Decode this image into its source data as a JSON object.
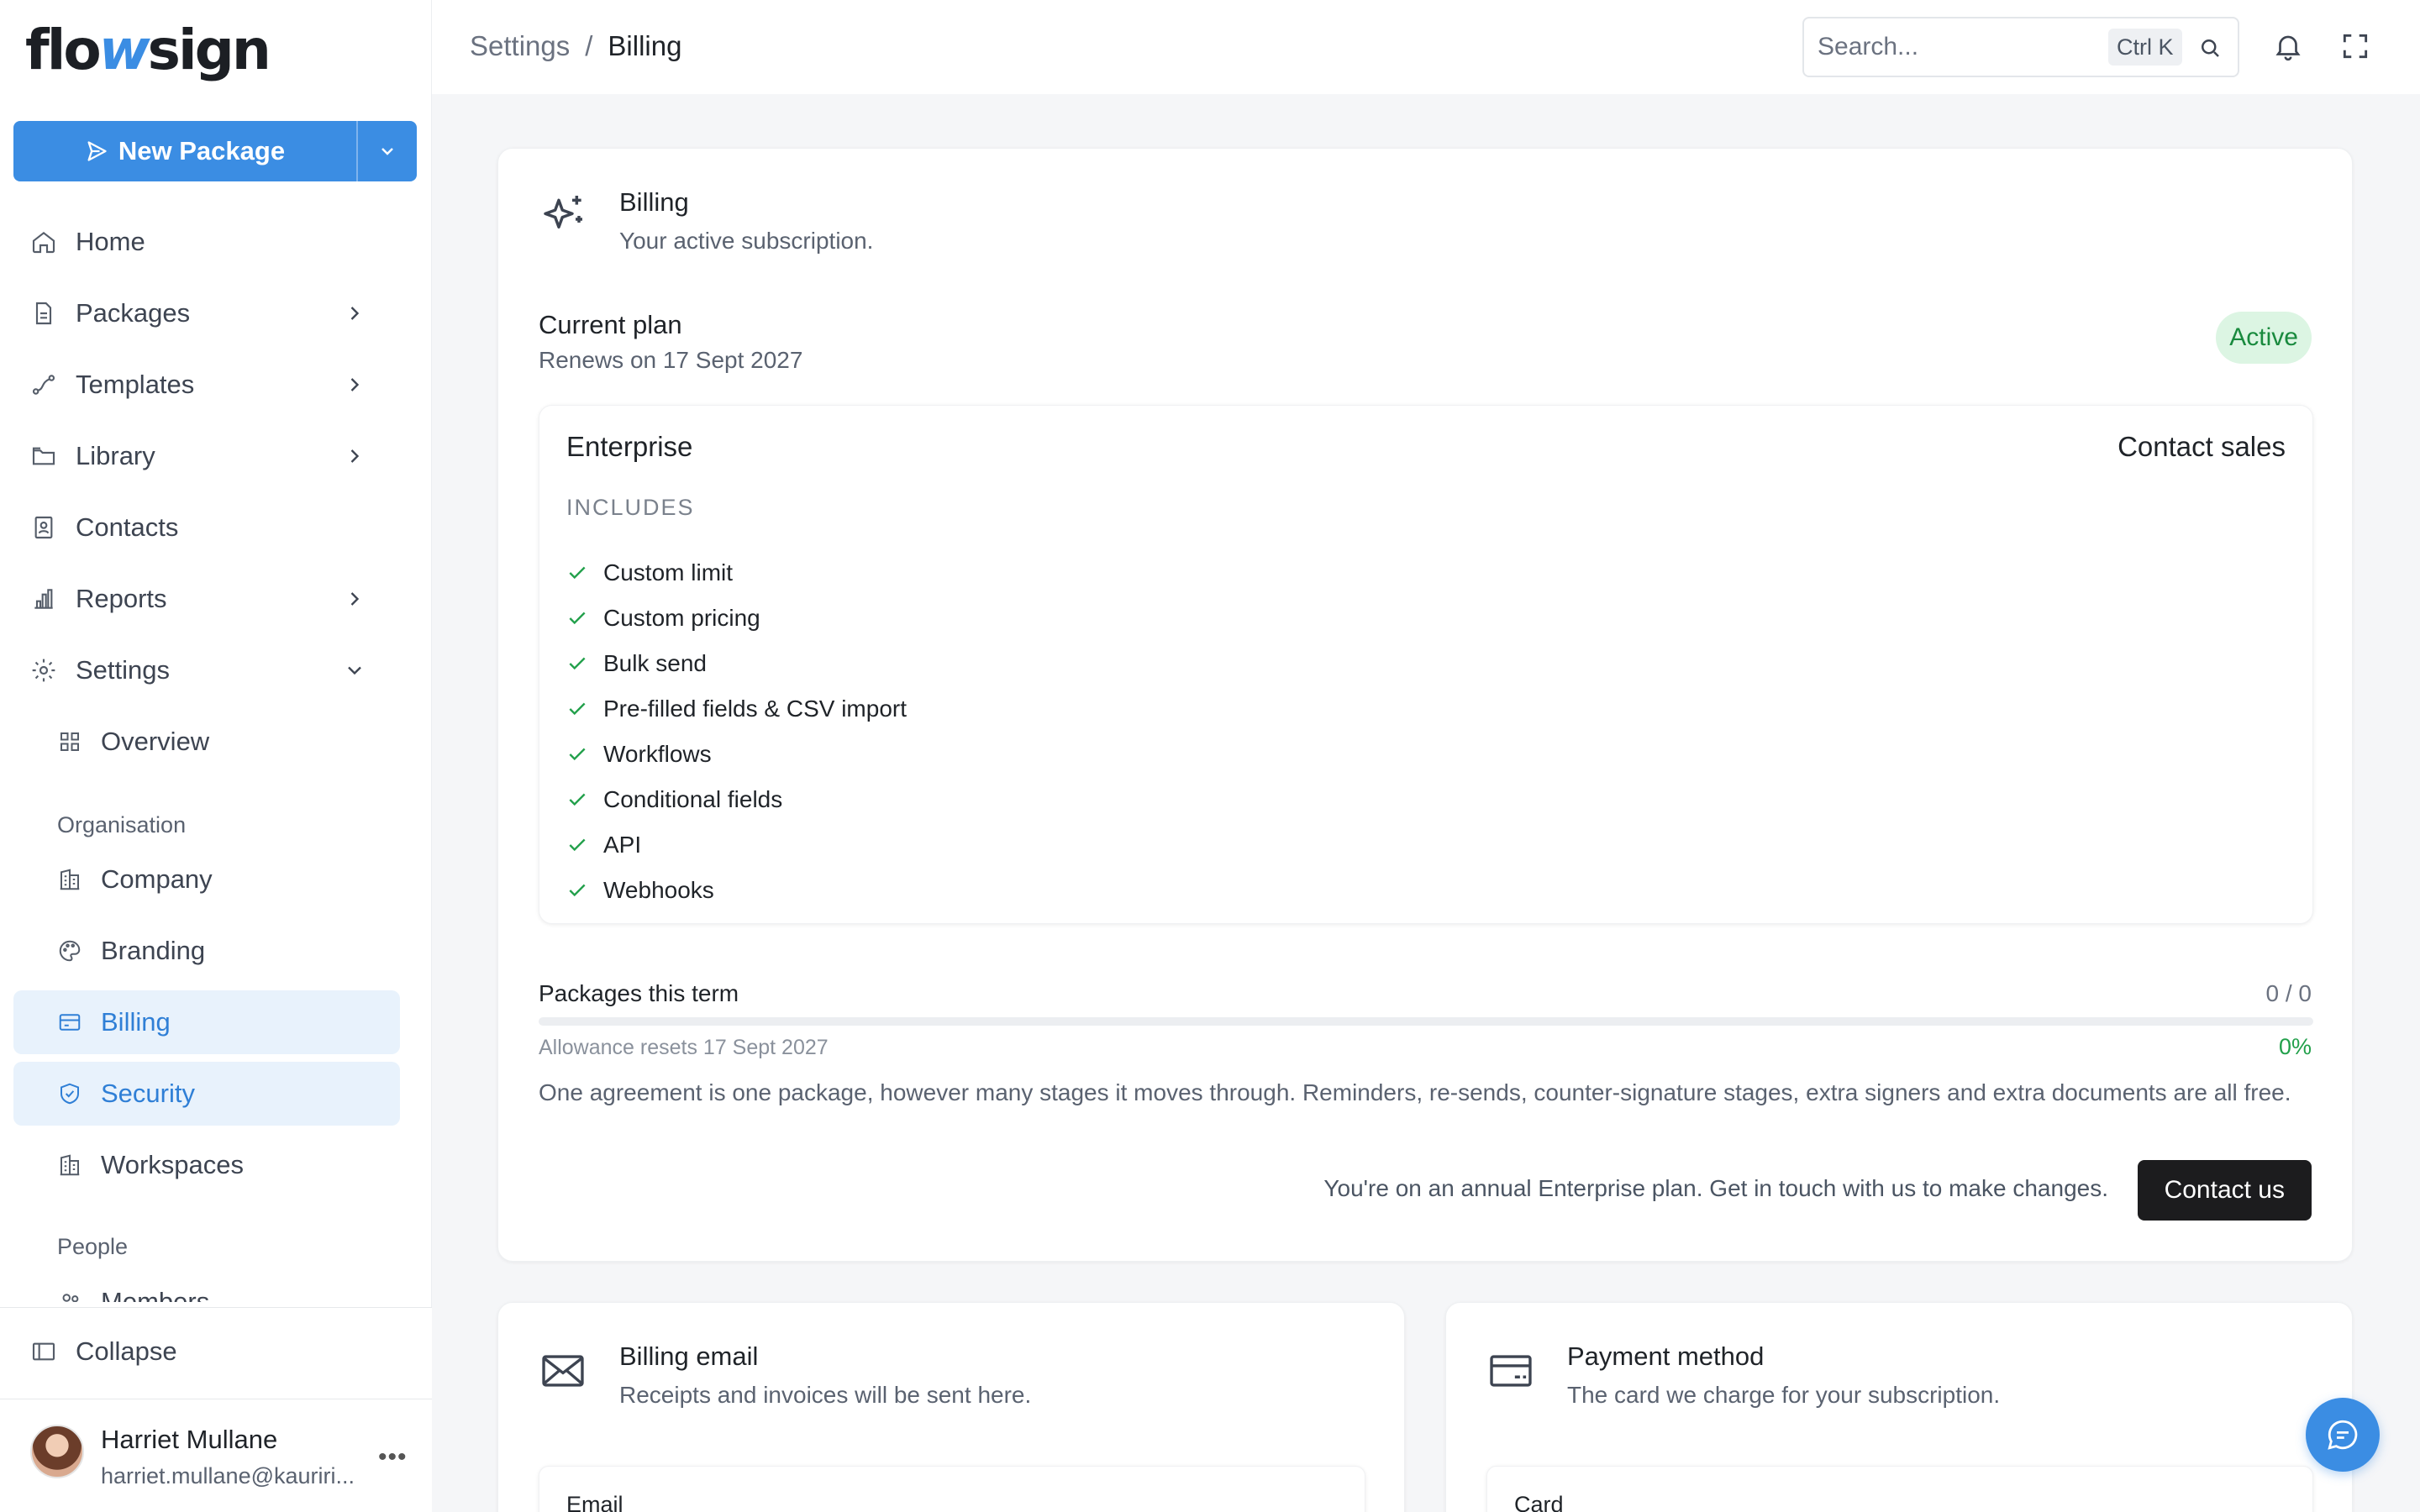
{
  "app": {
    "logo_prefix": "flo",
    "logo_mark": "w",
    "logo_suffix": "sign",
    "primary_color": "#3b8de3"
  },
  "sidebar": {
    "new_package_label": "New Package",
    "items": [
      {
        "label": "Home",
        "icon": "home-icon"
      },
      {
        "label": "Packages",
        "icon": "document-icon",
        "has_submenu": true
      },
      {
        "label": "Templates",
        "icon": "route-icon",
        "has_submenu": true
      },
      {
        "label": "Library",
        "icon": "folder-icon",
        "has_submenu": true
      },
      {
        "label": "Contacts",
        "icon": "contacts-icon"
      },
      {
        "label": "Reports",
        "icon": "bar-chart-icon",
        "has_submenu": true
      },
      {
        "label": "Settings",
        "icon": "gear-icon",
        "expanded": true
      }
    ],
    "settings_overview": "Overview",
    "org_heading": "Organisation",
    "org_items": [
      {
        "label": "Company",
        "icon": "building-icon"
      },
      {
        "label": "Branding",
        "icon": "palette-icon"
      },
      {
        "label": "Billing",
        "icon": "credit-card-icon",
        "active": true
      },
      {
        "label": "Security",
        "icon": "shield-check-icon",
        "highlighted": true
      },
      {
        "label": "Workspaces",
        "icon": "building-icon"
      }
    ],
    "people_heading": "People",
    "people_items": [
      {
        "label": "Members",
        "icon": "users-icon"
      }
    ],
    "collapse_label": "Collapse",
    "user": {
      "name": "Harriet Mullane",
      "email": "harriet.mullane@kauriri..."
    }
  },
  "header": {
    "breadcrumb": [
      "Settings",
      "Billing"
    ],
    "breadcrumb_separator": "/",
    "search_placeholder": "Search...",
    "search_shortcut": "Ctrl K"
  },
  "billing": {
    "title": "Billing",
    "subtitle": "Your active subscription.",
    "current_plan_label": "Current plan",
    "renews": "Renews on 17 Sept 2027",
    "status": "Active",
    "plan": {
      "name": "Enterprise",
      "price": "Contact sales",
      "includes_label": "INCLUDES",
      "features": [
        "Custom limit",
        "Custom pricing",
        "Bulk send",
        "Pre-filled fields & CSV import",
        "Workflows",
        "Conditional fields",
        "API",
        "Webhooks"
      ]
    },
    "usage": {
      "label": "Packages this term",
      "count": "0 / 0",
      "reset": "Allowance resets 17 Sept 2027",
      "percent_label": "0%",
      "fraction": 0,
      "note": "One agreement is one package, however many stages it moves through. Reminders, re-sends, counter-signature stages, extra signers and extra documents are all free."
    },
    "annual_note": "You're on an annual Enterprise plan. Get in touch with us to make changes.",
    "contact_button": "Contact us"
  },
  "billing_email": {
    "title": "Billing email",
    "subtitle": "Receipts and invoices will be sent here.",
    "field_label": "Email"
  },
  "payment_method": {
    "title": "Payment method",
    "subtitle": "The card we charge for your subscription.",
    "field_label": "Card"
  },
  "colors": {
    "active_bg": "#dcf5e3",
    "active_text": "#198a3e",
    "check": "#22a04b",
    "nav_active_bg": "#e8f2fc"
  }
}
